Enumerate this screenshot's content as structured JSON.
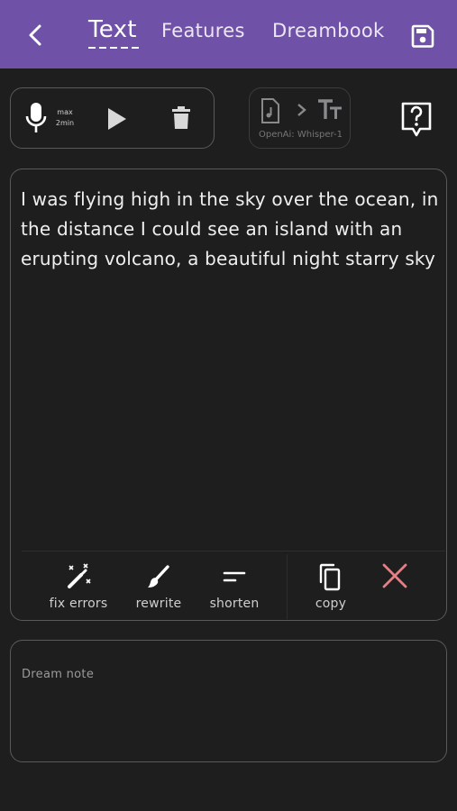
{
  "header": {
    "tabs": [
      {
        "label": "Text",
        "active": true
      },
      {
        "label": "Features"
      },
      {
        "label": "Dreambook"
      }
    ],
    "accent_color": "#7051a8"
  },
  "recorder": {
    "max_label": "max",
    "duration_label": "2min"
  },
  "engine": {
    "label": "OpenAi: Whisper-1"
  },
  "dream": {
    "text": "I was flying high in the sky over the ocean, in the distance I could see an island with an erupting volcano, a beautiful night starry sky"
  },
  "toolbar": {
    "fix_errors": "fix errors",
    "rewrite": "rewrite",
    "shorten": "shorten",
    "copy": "copy",
    "close_color": "#e57f85"
  },
  "note": {
    "placeholder": "Dream note"
  }
}
